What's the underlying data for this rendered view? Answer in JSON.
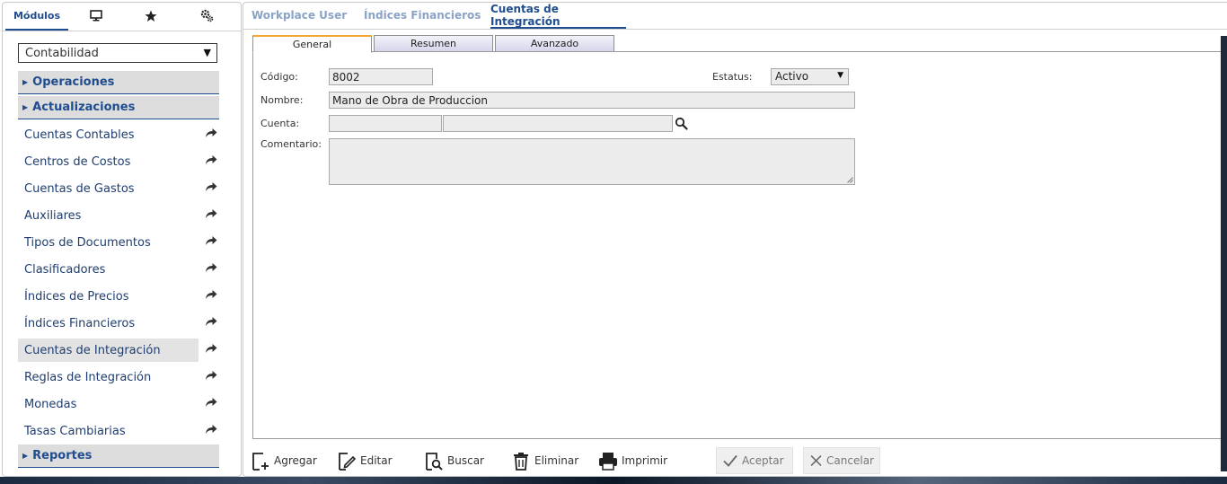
{
  "sidebar": {
    "tabs": [
      {
        "label": "Módulos",
        "icon": null,
        "active": true
      },
      {
        "label": "",
        "icon": "monitor-icon",
        "active": false
      },
      {
        "label": "",
        "icon": "star-icon",
        "active": false
      },
      {
        "label": "",
        "icon": "settings-icon",
        "active": false
      }
    ],
    "module_select": {
      "value": "Contabilidad"
    },
    "sections": {
      "operaciones": "Operaciones",
      "actualizaciones": "Actualizaciones",
      "reportes": "Reportes"
    },
    "items": [
      {
        "label": "Cuentas Contables"
      },
      {
        "label": "Centros de Costos"
      },
      {
        "label": "Cuentas de Gastos"
      },
      {
        "label": "Auxiliares"
      },
      {
        "label": "Tipos de Documentos"
      },
      {
        "label": "Clasificadores"
      },
      {
        "label": "Índices de Precios"
      },
      {
        "label": "Índices Financieros"
      },
      {
        "label": "Cuentas de Integración"
      },
      {
        "label": "Reglas de Integración"
      },
      {
        "label": "Monedas"
      },
      {
        "label": "Tasas Cambiarias"
      }
    ],
    "selected_item": "Cuentas de Integración"
  },
  "header": {
    "tabs": [
      {
        "label": "Workplace User"
      },
      {
        "label": "Índices Financieros"
      },
      {
        "label": "Cuentas de Integración"
      }
    ],
    "active_tab": "Cuentas de Integración"
  },
  "form": {
    "subtabs": [
      {
        "label": "General"
      },
      {
        "label": "Resumen"
      },
      {
        "label": "Avanzado"
      }
    ],
    "active_subtab": "General",
    "codigo": {
      "label": "Código:",
      "value": "8002"
    },
    "estatus": {
      "label": "Estatus:",
      "value": "Activo"
    },
    "nombre": {
      "label": "Nombre:",
      "value": "Mano de Obra de Produccion"
    },
    "cuenta": {
      "label": "Cuenta:",
      "code": "",
      "description": ""
    },
    "comentario": {
      "label": "Comentario:",
      "value": ""
    }
  },
  "toolbar": {
    "agregar": "Agregar",
    "editar": "Editar",
    "buscar": "Buscar",
    "eliminar": "Eliminar",
    "imprimir": "Imprimir",
    "aceptar": "Aceptar",
    "cancelar": "Cancelar"
  },
  "colors": {
    "accent": "#1f4d8f",
    "active_subtab_border": "#f0a830",
    "section_bg": "#dddddd",
    "field_bg": "#ececec"
  }
}
